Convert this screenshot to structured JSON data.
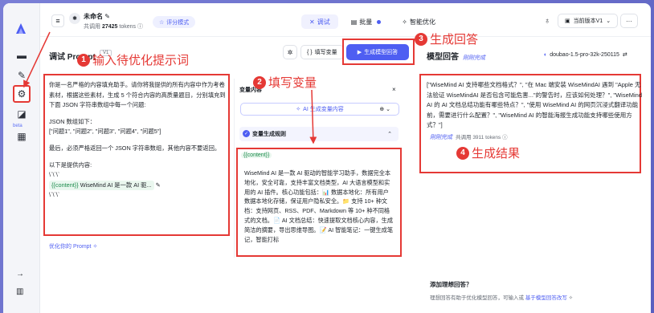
{
  "topbar": {
    "project_name": "未命名",
    "calls_prefix": "共调用",
    "calls_value": "27425",
    "calls_suffix": "tokens",
    "score_mode": "评分模式",
    "modes": [
      {
        "label": "调试",
        "active": true
      },
      {
        "label": "批量",
        "active": false
      },
      {
        "label": "智能优化",
        "active": false
      }
    ],
    "version": "当前版本V1",
    "more": "···"
  },
  "prompt": {
    "title": "调试 Prompt",
    "version_tag": "V1",
    "fill_vars": "填写变量",
    "generate": "生成模型回答",
    "paragraphs": [
      "你是一名严格的内容填充助手。请你将我提供的所有内容中作为考卷素材，根据这些素材，生成 5 个符合内容的高质量题目，分别填充到下面 JSON 字符串数组中每一个问题:",
      "JSON 数组如下：",
      "[\"问题1\", \"问题2\", \"问题3\", \"问题4\", \"问题5\"]",
      "最后，必须严格返回一个 JSON 字符串数组，其他内容不要返回。",
      "以下是提供内容:",
      "\\`\\`\\`"
    ],
    "var_chip": "{{content}}",
    "var_preview": "WiseMind AI 是一款 AI 驱...",
    "closing": "\\`\\`\\`",
    "optimize_link": "优化你的 Prompt"
  },
  "variables": {
    "header": "变量内容",
    "ai_generate": "AI 生成变量内容",
    "rules_label": "变量生成规则",
    "var_name": "{{content}}",
    "var_text": "WiseMind AI 是一款 AI 驱动的智能学习助手，数据完全本地化，安全可靠，支持丰富文档类型，AI 大语言模型和实用的 AI 插件。核心功能包括：📊 数据本地化：所有用户数据本地化存储，保证用户隐私安全。📁 支持 10+ 种文档：支持网页、RSS、PDF、Markdown 等 10+ 种不同格式的文档。📄 AI 文档总结：快速提取文档核心内容，生成简洁的摘要，导出思维导图。📝 AI 智能笔记：一键生成笔记，智能打标"
  },
  "answer": {
    "title": "模型回答",
    "tag": "刚刚完成",
    "model": "doubao-1.5-pro-32k-250115",
    "text": "[\"WiseMind AI 支持哪些文档格式？\", \"在 Mac 端安装 WiseMindAI 遇到 \"Apple 无法验证 WiseMindAI 是否包含可能危害...\"的警告时，应该如何处理？\", \"WiseMind AI 的 AI 文档总结功能有哪些特点？\", \"使用 WiseMind AI 的网页沉浸式翻译功能前，需要进行什么配置？\", \"WiseMind AI 的智能海报生成功能支持哪些使用方式？\"]",
    "meta_tag": "刚刚完成",
    "meta_prefix": "共调用",
    "meta_value": "3911",
    "meta_suffix": "tokens",
    "add_ideal": "添加理想回答？",
    "ideal_desc": "理想回答有助于优化模型回答，可输入或",
    "ideal_link": "基于模型回答改写"
  },
  "annotations": [
    {
      "num": "1",
      "text": "输入待优化提示词"
    },
    {
      "num": "2",
      "text": "填写变量"
    },
    {
      "num": "3",
      "text": "生成回答"
    },
    {
      "num": "4",
      "text": "生成结果"
    }
  ],
  "rail": {
    "beta": "beta"
  }
}
